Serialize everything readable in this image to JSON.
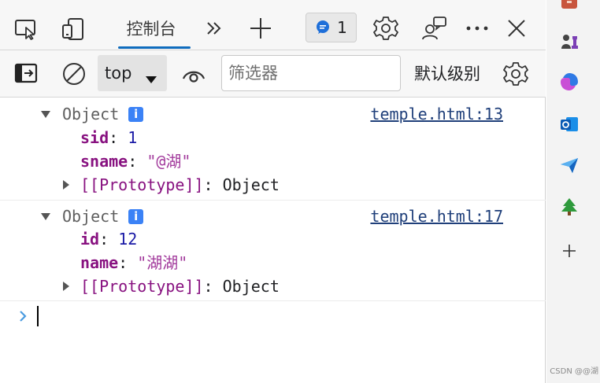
{
  "tabs": {
    "console_label": "控制台",
    "message_count": "1"
  },
  "toolbar": {
    "context_value": "top",
    "filter_placeholder": "筛选器",
    "levels_label": "默认级别"
  },
  "console": {
    "entries": [
      {
        "label": "Object",
        "info": "i",
        "source": "temple.html:13",
        "props": [
          {
            "key": "sid",
            "sep": ": ",
            "value": "1"
          },
          {
            "key": "sname",
            "sep": ": ",
            "value": "\"@湖\""
          }
        ],
        "prototype": {
          "key": "[[Prototype]]",
          "sep": ": ",
          "value": "Object"
        }
      },
      {
        "label": "Object",
        "info": "i",
        "source": "temple.html:17",
        "props": [
          {
            "key": "id",
            "sep": ": ",
            "value": "12"
          },
          {
            "key": "name",
            "sep": ": ",
            "value": "\"湖湖\""
          }
        ],
        "prototype": {
          "key": "[[Prototype]]",
          "sep": ": ",
          "value": "Object"
        }
      }
    ]
  },
  "sidebar": {
    "icons": [
      "toolbox-icon",
      "chess-icon",
      "copilot-icon",
      "outlook-icon",
      "send-icon",
      "tree-icon",
      "add-icon"
    ]
  },
  "watermark": "CSDN @@湖",
  "colors": {
    "accent": "#0f6cbd",
    "info_badge": "#3b82f6",
    "key": "#881280",
    "number": "#1a1aa6",
    "string": "#a23a9c",
    "prompt": "#4a9be0"
  }
}
